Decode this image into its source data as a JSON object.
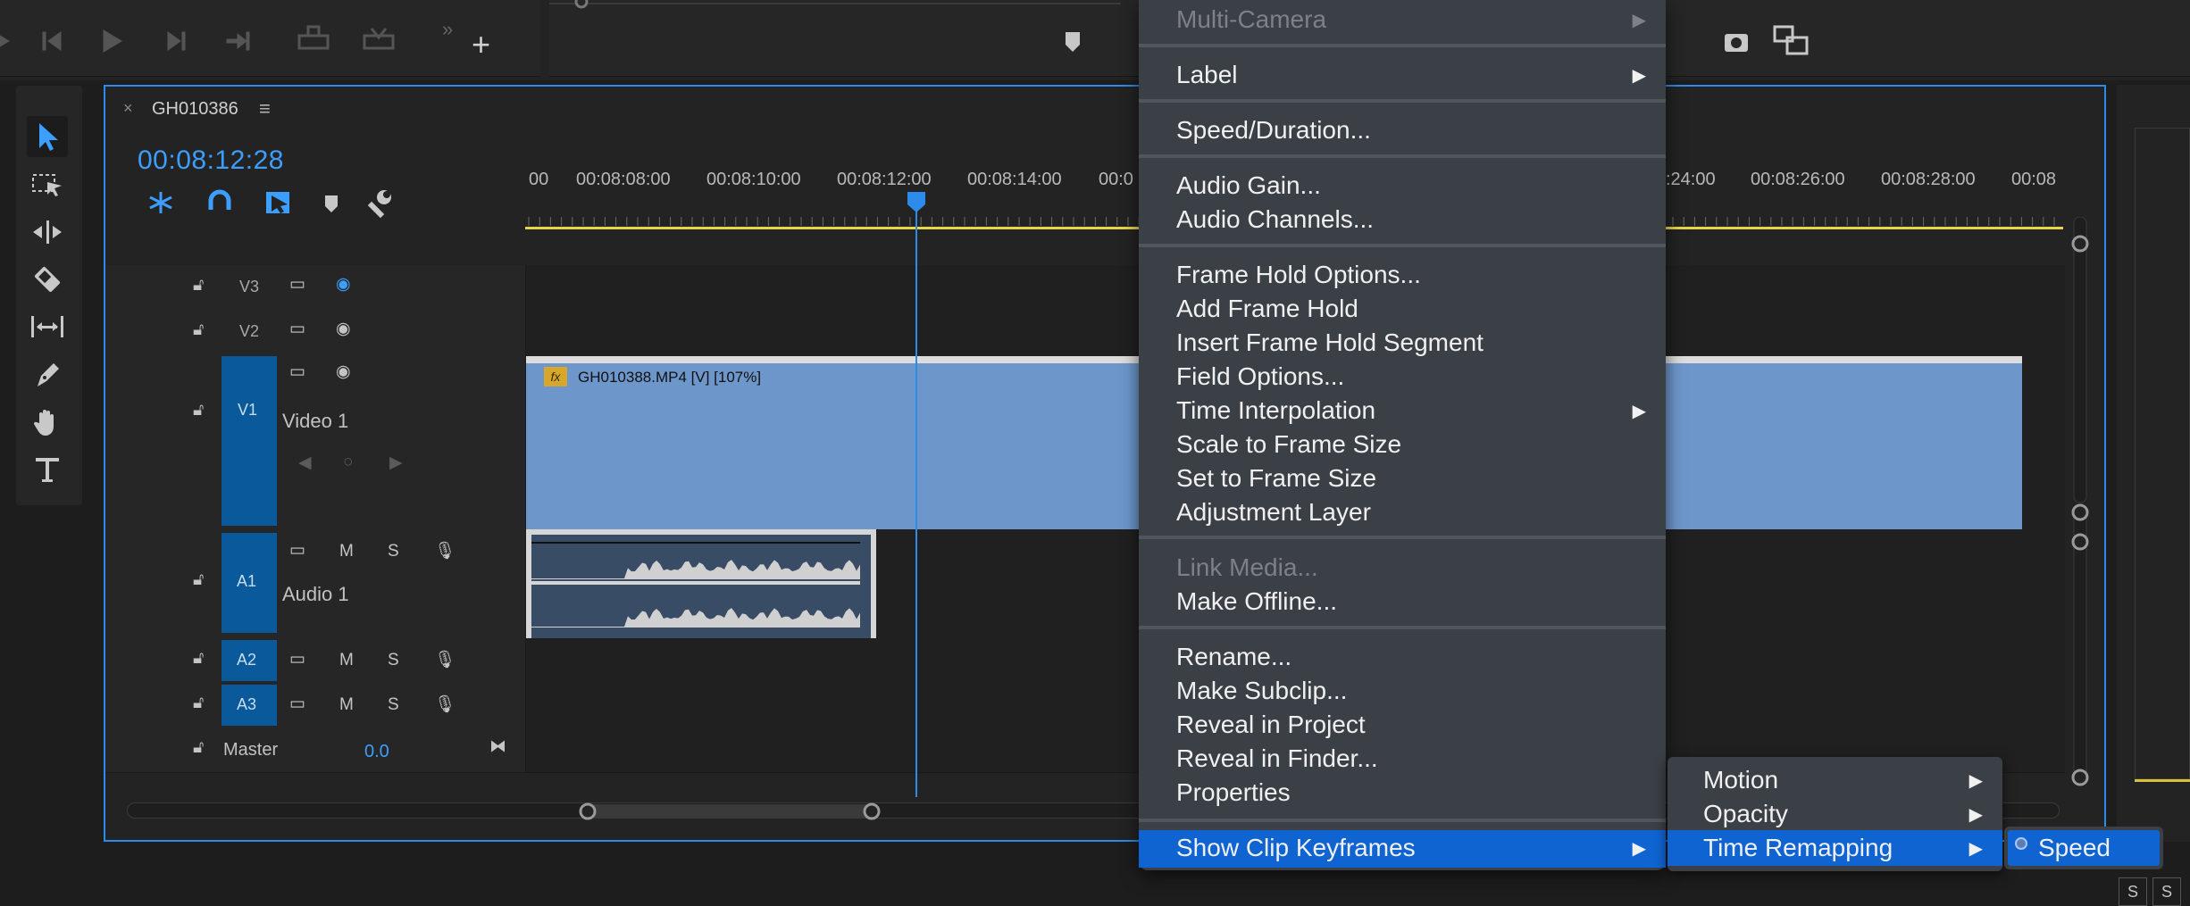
{
  "timeline": {
    "sequence_name": "GH010386",
    "timecode": "00:08:12:28",
    "ruler_labels": [
      "00",
      "00:08:08:00",
      "00:08:10:00",
      "00:08:12:00",
      "00:08:14:00",
      "00:0",
      ":24:00",
      "00:08:26:00",
      "00:08:28:00",
      "00:08"
    ],
    "tracks": {
      "v3": {
        "label": "V3"
      },
      "v2": {
        "label": "V2"
      },
      "v1": {
        "label": "V1",
        "name": "Video 1"
      },
      "a1": {
        "label": "A1",
        "name": "Audio 1",
        "mute": "M",
        "solo": "S"
      },
      "a2": {
        "label": "A2",
        "mute": "M",
        "solo": "S"
      },
      "a3": {
        "label": "A3",
        "mute": "M",
        "solo": "S"
      },
      "master": {
        "name": "Master",
        "value": "0.0"
      }
    },
    "clip": {
      "label": "GH010388.MP4 [V] [107%]",
      "fx": "fx"
    }
  },
  "context_menu": {
    "items": [
      {
        "label": "Multi-Camera",
        "disabled": true,
        "submenu": true
      },
      {
        "label": "Label",
        "submenu": true
      },
      {
        "label": "Speed/Duration..."
      },
      {
        "label": "Audio Gain..."
      },
      {
        "label": "Audio Channels..."
      },
      {
        "label": "Frame Hold Options..."
      },
      {
        "label": "Add Frame Hold"
      },
      {
        "label": "Insert Frame Hold Segment"
      },
      {
        "label": "Field Options..."
      },
      {
        "label": "Time Interpolation",
        "submenu": true
      },
      {
        "label": "Scale to Frame Size"
      },
      {
        "label": "Set to Frame Size"
      },
      {
        "label": "Adjustment Layer"
      },
      {
        "label": "Link Media...",
        "disabled": true
      },
      {
        "label": "Make Offline..."
      },
      {
        "label": "Rename..."
      },
      {
        "label": "Make Subclip..."
      },
      {
        "label": "Reveal in Project"
      },
      {
        "label": "Reveal in Finder..."
      },
      {
        "label": "Properties"
      },
      {
        "label": "Show Clip Keyframes",
        "submenu": true,
        "highlighted": true
      }
    ]
  },
  "submenu": {
    "items": [
      {
        "label": "Motion"
      },
      {
        "label": "Opacity"
      },
      {
        "label": "Time Remapping",
        "highlighted": true
      }
    ]
  },
  "submenu2": {
    "items": [
      {
        "label": "Speed",
        "highlighted": true
      }
    ]
  },
  "right_panel": {
    "s1": "S",
    "s2": "S"
  },
  "colors": {
    "accent": "#2d8ceb",
    "clip_video": "#6d97cb",
    "menu_bg": "#3b3f46",
    "menu_highlight": "#0f64d2"
  }
}
